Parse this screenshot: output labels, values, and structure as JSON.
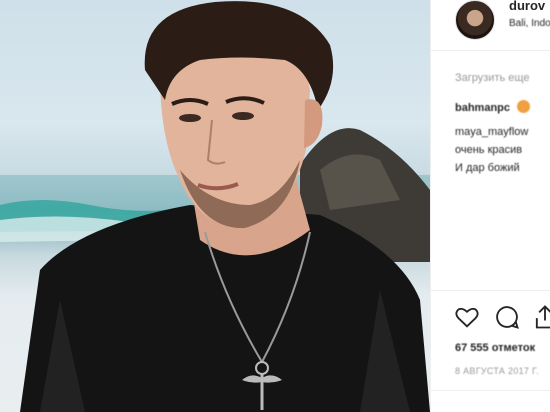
{
  "photo": {
    "alt": "post-photo"
  },
  "post": {
    "username": "durov",
    "location": "Bali, Indonesia",
    "load_more": "Загрузить еще",
    "comments": [
      {
        "user": "bahmanpc",
        "text": "",
        "emoji": true
      },
      {
        "user": "maya_mayflow",
        "text": ""
      },
      {
        "user": "",
        "text": "очень красив"
      },
      {
        "user": "",
        "text": "И дар божий"
      }
    ],
    "likes": "67 555 отметок",
    "date": "8 АВГУСТА 2017 Г."
  },
  "icons": {
    "like": "heart-icon",
    "comment": "comment-icon",
    "share": "share-icon"
  },
  "colors": {
    "text": "#262626",
    "muted": "#999999",
    "border": "#efefef"
  }
}
